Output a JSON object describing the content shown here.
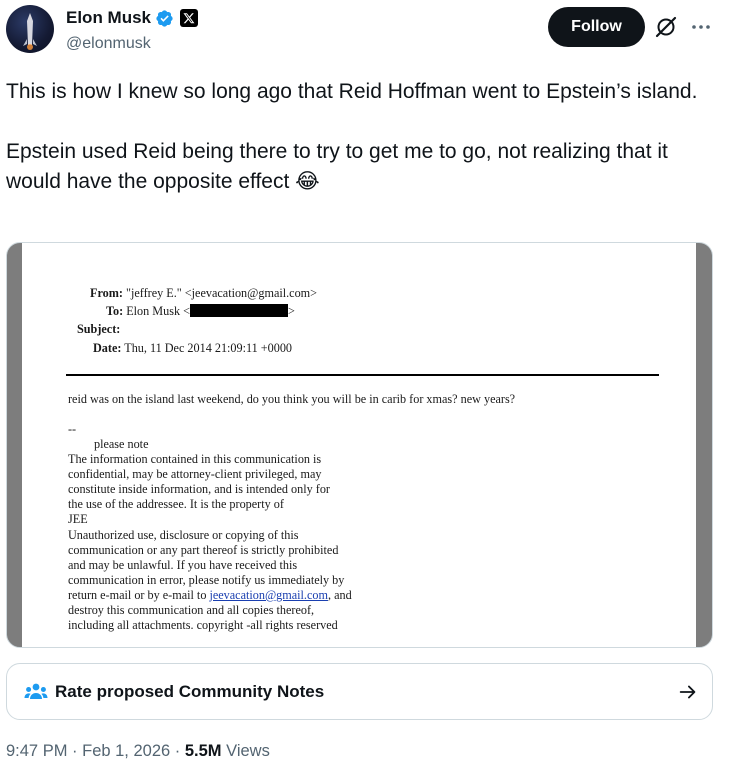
{
  "author": {
    "name": "Elon Musk",
    "handle": "@elonmusk"
  },
  "actions": {
    "follow_label": "Follow"
  },
  "tweet": {
    "paragraph1": "This is how I knew so long ago that Reid Hoffman went to Epstein’s island.",
    "paragraph2": "Epstein used Reid being there to try to get me to go, not realizing that it would have the opposite effect 😂"
  },
  "document": {
    "from_label": "From:",
    "from_value": "\"jeffrey E.\" <jeevacation@gmail.com>",
    "to_label": "To:",
    "to_value_prefix": "Elon Musk <",
    "to_value_suffix": ">",
    "subject_label": "Subject:",
    "date_label": "Date:",
    "date_value": "Thu, 11 Dec 2014 21:09:11 +0000",
    "message": "reid was on the island last weekend,   do you think you will be in carib for xmas? new years?",
    "sig_dash": "--",
    "please_note": "please note",
    "lines": [
      "The information contained in this communication is",
      "confidential, may be attorney-client privileged, may",
      "constitute inside information, and is intended only for",
      "the use of the addressee. It is the property of",
      "JEE",
      "Unauthorized use, disclosure or copying of this",
      "communication or any part thereof is strictly prohibited",
      "and may be unlawful. If you have received this",
      "communication in error, please notify us immediately by"
    ],
    "email_line_prefix": "return e-mail or by e-mail to ",
    "email_link": "jeevacation@gmail.com",
    "email_line_suffix": ", and",
    "closing_lines": [
      "destroy this communication and all copies thereof,",
      "including all attachments. copyright -all rights reserved"
    ]
  },
  "community_notes": {
    "label": "Rate proposed Community Notes"
  },
  "meta": {
    "time": "9:47 PM · Feb 1, 2026 · ",
    "views_count": "5.5M",
    "views_label": " Views"
  },
  "colors": {
    "verified": "#1d9bf0",
    "text_primary": "#0f1419",
    "text_secondary": "#536471",
    "link": "#1a3fb0"
  },
  "icons": [
    "verified-badge-icon",
    "x-logo-icon",
    "grok-icon",
    "more-icon",
    "community-notes-icon",
    "arrow-right-icon"
  ]
}
